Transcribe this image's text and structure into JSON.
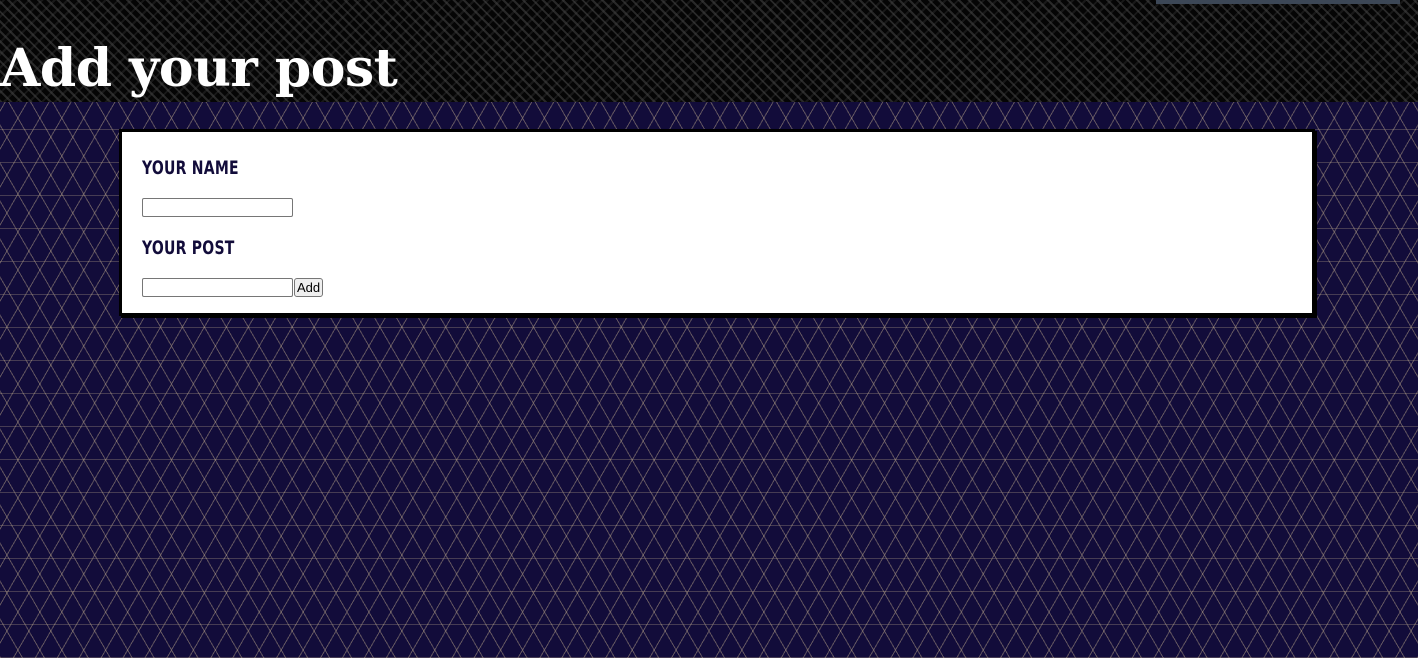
{
  "header": {
    "title": "Add your post"
  },
  "form": {
    "name_label": "Your Name",
    "name_value": "",
    "post_label": "Your Post",
    "post_value": "",
    "submit_label": "Add"
  },
  "colors": {
    "page_background": "#120c3a",
    "header_background": "#050505",
    "label_color": "#120c3a",
    "card_background": "#ffffff",
    "card_border": "#000000"
  }
}
